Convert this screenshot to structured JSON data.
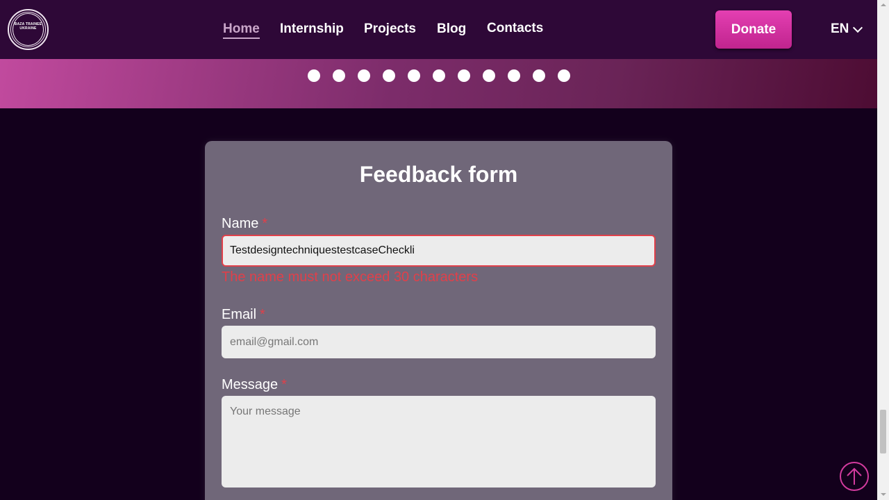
{
  "logo": {
    "text": "BAZA TRAINEE UKRAINE"
  },
  "nav": {
    "items": [
      {
        "label": "Home",
        "active": true
      },
      {
        "label": "Internship",
        "active": false
      },
      {
        "label": "Projects",
        "active": false
      },
      {
        "label": "Blog",
        "active": false
      },
      {
        "label": "Contacts",
        "active": false
      }
    ]
  },
  "header": {
    "donate_label": "Donate",
    "language": "EN"
  },
  "banner": {
    "dot_count": 11
  },
  "form": {
    "title": "Feedback form",
    "name_label": "Name",
    "name_value": "TestdesigntechniquestestcaseCheckli",
    "name_error": "The name must not exceed 30 characters",
    "email_label": "Email",
    "email_placeholder": "email@gmail.com",
    "message_label": "Message",
    "message_placeholder": "Your message",
    "required_mark": "*"
  },
  "colors": {
    "header_bg": "#2e0837",
    "page_bg": "#13001c",
    "accent": "#e43fb2",
    "error": "#e0404a",
    "card_bg": "#706779"
  }
}
